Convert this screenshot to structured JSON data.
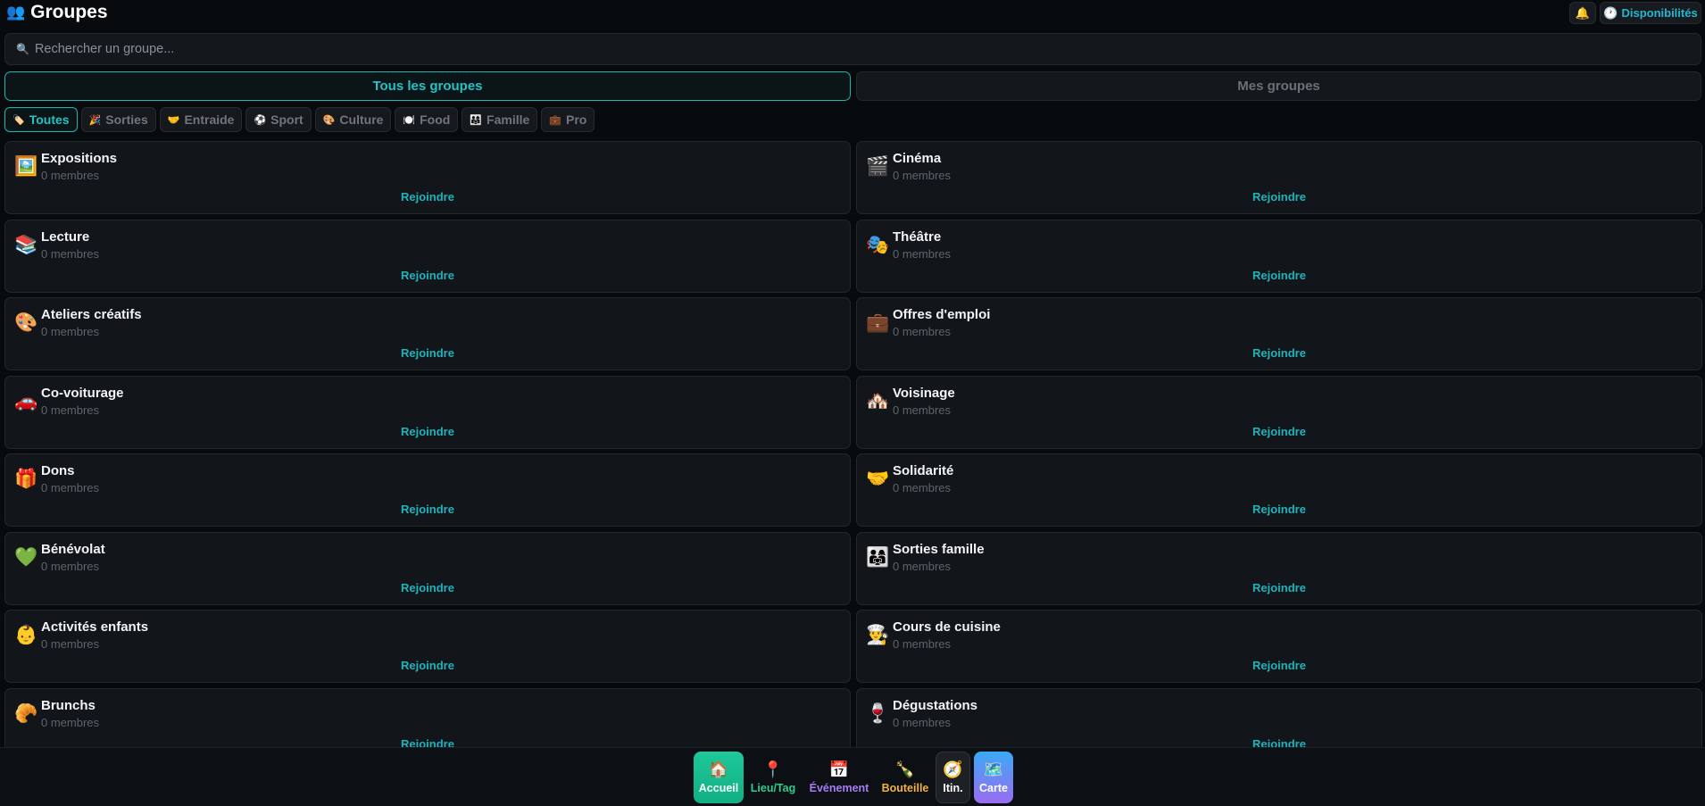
{
  "header": {
    "title_icon": "👥",
    "title": "Groupes",
    "bell_icon": "🔔",
    "dispo_icon": "🕐",
    "dispo_label": "Disponibilités"
  },
  "search": {
    "icon": "🔍",
    "placeholder": "Rechercher un groupe..."
  },
  "tabs": [
    {
      "label": "Tous les groupes",
      "active": true
    },
    {
      "label": "Mes groupes",
      "active": false
    }
  ],
  "chips": [
    {
      "icon": "🏷️",
      "label": "Toutes",
      "active": true
    },
    {
      "icon": "🎉",
      "label": "Sorties"
    },
    {
      "icon": "🤝",
      "label": "Entraide"
    },
    {
      "icon": "⚽",
      "label": "Sport"
    },
    {
      "icon": "🎨",
      "label": "Culture"
    },
    {
      "icon": "🍽️",
      "label": "Food"
    },
    {
      "icon": "👨‍👩‍👧",
      "label": "Famille"
    },
    {
      "icon": "💼",
      "label": "Pro"
    }
  ],
  "groups": [
    {
      "icon": "🖼️",
      "name": "Expositions",
      "members": "0 membres",
      "action": "Rejoindre"
    },
    {
      "icon": "🎬",
      "name": "Cinéma",
      "members": "0 membres",
      "action": "Rejoindre"
    },
    {
      "icon": "📚",
      "name": "Lecture",
      "members": "0 membres",
      "action": "Rejoindre"
    },
    {
      "icon": "🎭",
      "name": "Théâtre",
      "members": "0 membres",
      "action": "Rejoindre"
    },
    {
      "icon": "🎨",
      "name": "Ateliers créatifs",
      "members": "0 membres",
      "action": "Rejoindre"
    },
    {
      "icon": "💼",
      "name": "Offres d'emploi",
      "members": "0 membres",
      "action": "Rejoindre"
    },
    {
      "icon": "🚗",
      "name": "Co-voiturage",
      "members": "0 membres",
      "action": "Rejoindre"
    },
    {
      "icon": "🏘️",
      "name": "Voisinage",
      "members": "0 membres",
      "action": "Rejoindre"
    },
    {
      "icon": "🎁",
      "name": "Dons",
      "members": "0 membres",
      "action": "Rejoindre"
    },
    {
      "icon": "🤝",
      "name": "Solidarité",
      "members": "0 membres",
      "action": "Rejoindre"
    },
    {
      "icon": "💚",
      "name": "Bénévolat",
      "members": "0 membres",
      "action": "Rejoindre"
    },
    {
      "icon": "👨‍👩‍👧",
      "name": "Sorties famille",
      "members": "0 membres",
      "action": "Rejoindre"
    },
    {
      "icon": "👶",
      "name": "Activités enfants",
      "members": "0 membres",
      "action": "Rejoindre"
    },
    {
      "icon": "👨‍🍳",
      "name": "Cours de cuisine",
      "members": "0 membres",
      "action": "Rejoindre"
    },
    {
      "icon": "🥐",
      "name": "Brunchs",
      "members": "0 membres",
      "action": "Rejoindre"
    },
    {
      "icon": "🍷",
      "name": "Dégustations",
      "members": "0 membres",
      "action": "Rejoindre"
    }
  ],
  "bottom_nav": [
    {
      "icon": "🏠",
      "label": "Accueil"
    },
    {
      "icon": "📍",
      "label": "Lieu/Tag"
    },
    {
      "icon": "📅",
      "label": "Événement"
    },
    {
      "icon": "🍾",
      "label": "Bouteille"
    },
    {
      "icon": "🧭",
      "label": "Itin."
    },
    {
      "icon": "🗺️",
      "label": "Carte"
    }
  ]
}
